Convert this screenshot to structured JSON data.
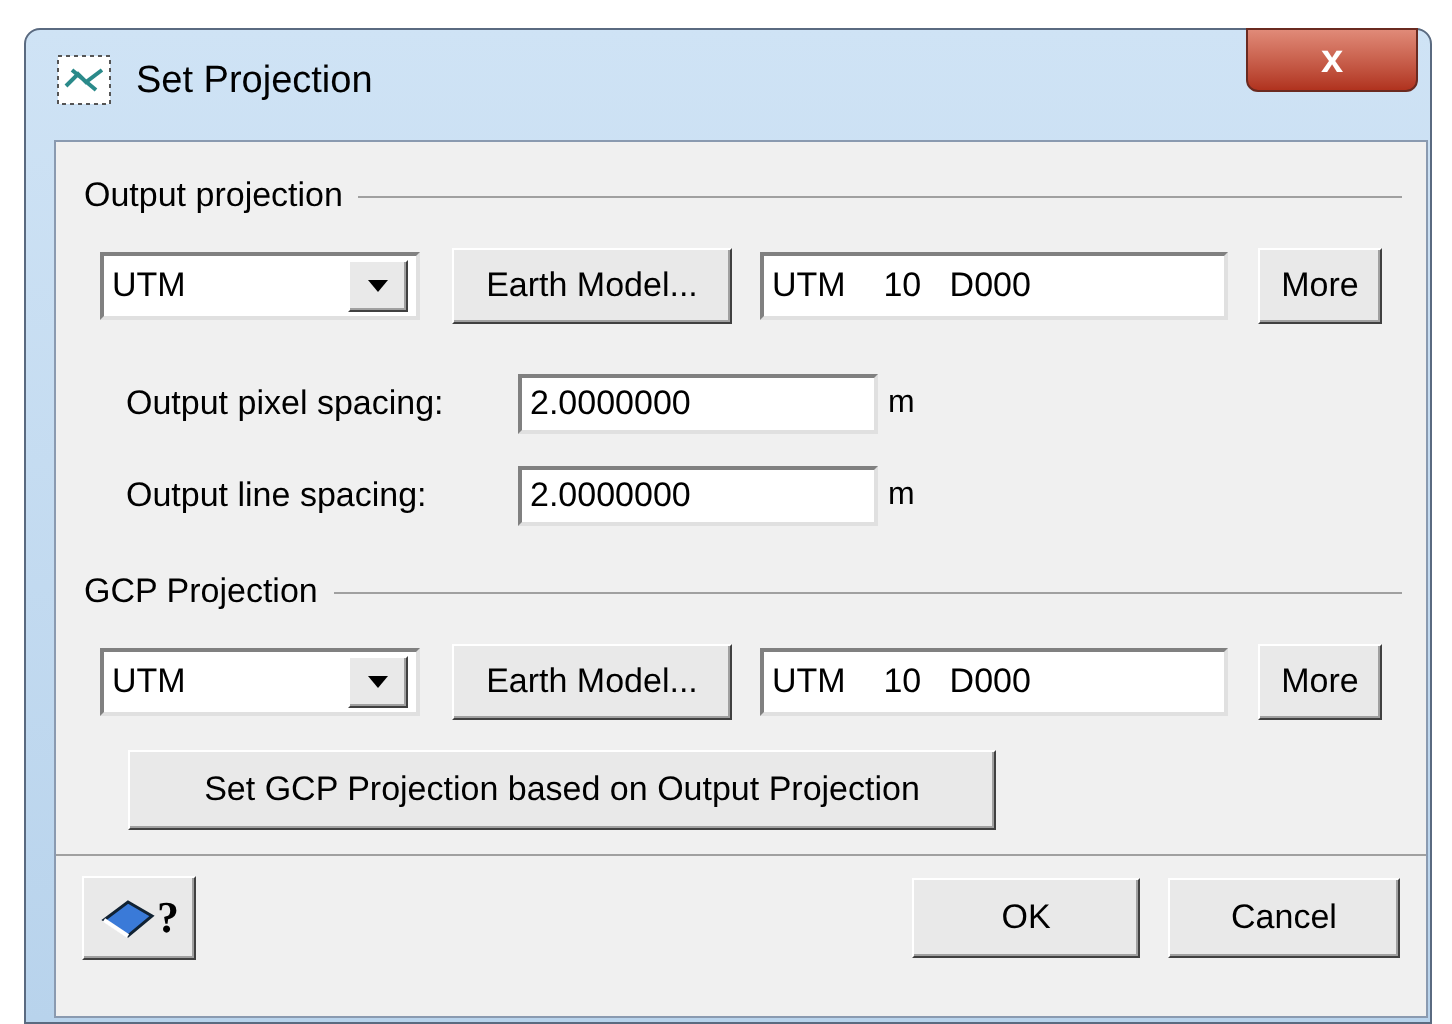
{
  "window": {
    "title": "Set Projection",
    "close": "x"
  },
  "sections": [
    {
      "title": "Output projection",
      "projection": "UTM",
      "earth_model_button": "Earth Model...",
      "code": "UTM    10   D000",
      "more_button": "More",
      "spacings": [
        {
          "label": "Output pixel spacing:",
          "value": "2.0000000",
          "unit": "m"
        },
        {
          "label": "Output line spacing:",
          "value": "2.0000000",
          "unit": "m"
        }
      ]
    },
    {
      "title": "GCP Projection",
      "projection": "UTM",
      "earth_model_button": "Earth Model...",
      "code": "UTM    10   D000",
      "more_button": "More",
      "action_button": "Set GCP Projection based on Output Projection"
    }
  ],
  "footer": {
    "help_mark": "?",
    "buttons": [
      "OK",
      "Cancel"
    ]
  }
}
